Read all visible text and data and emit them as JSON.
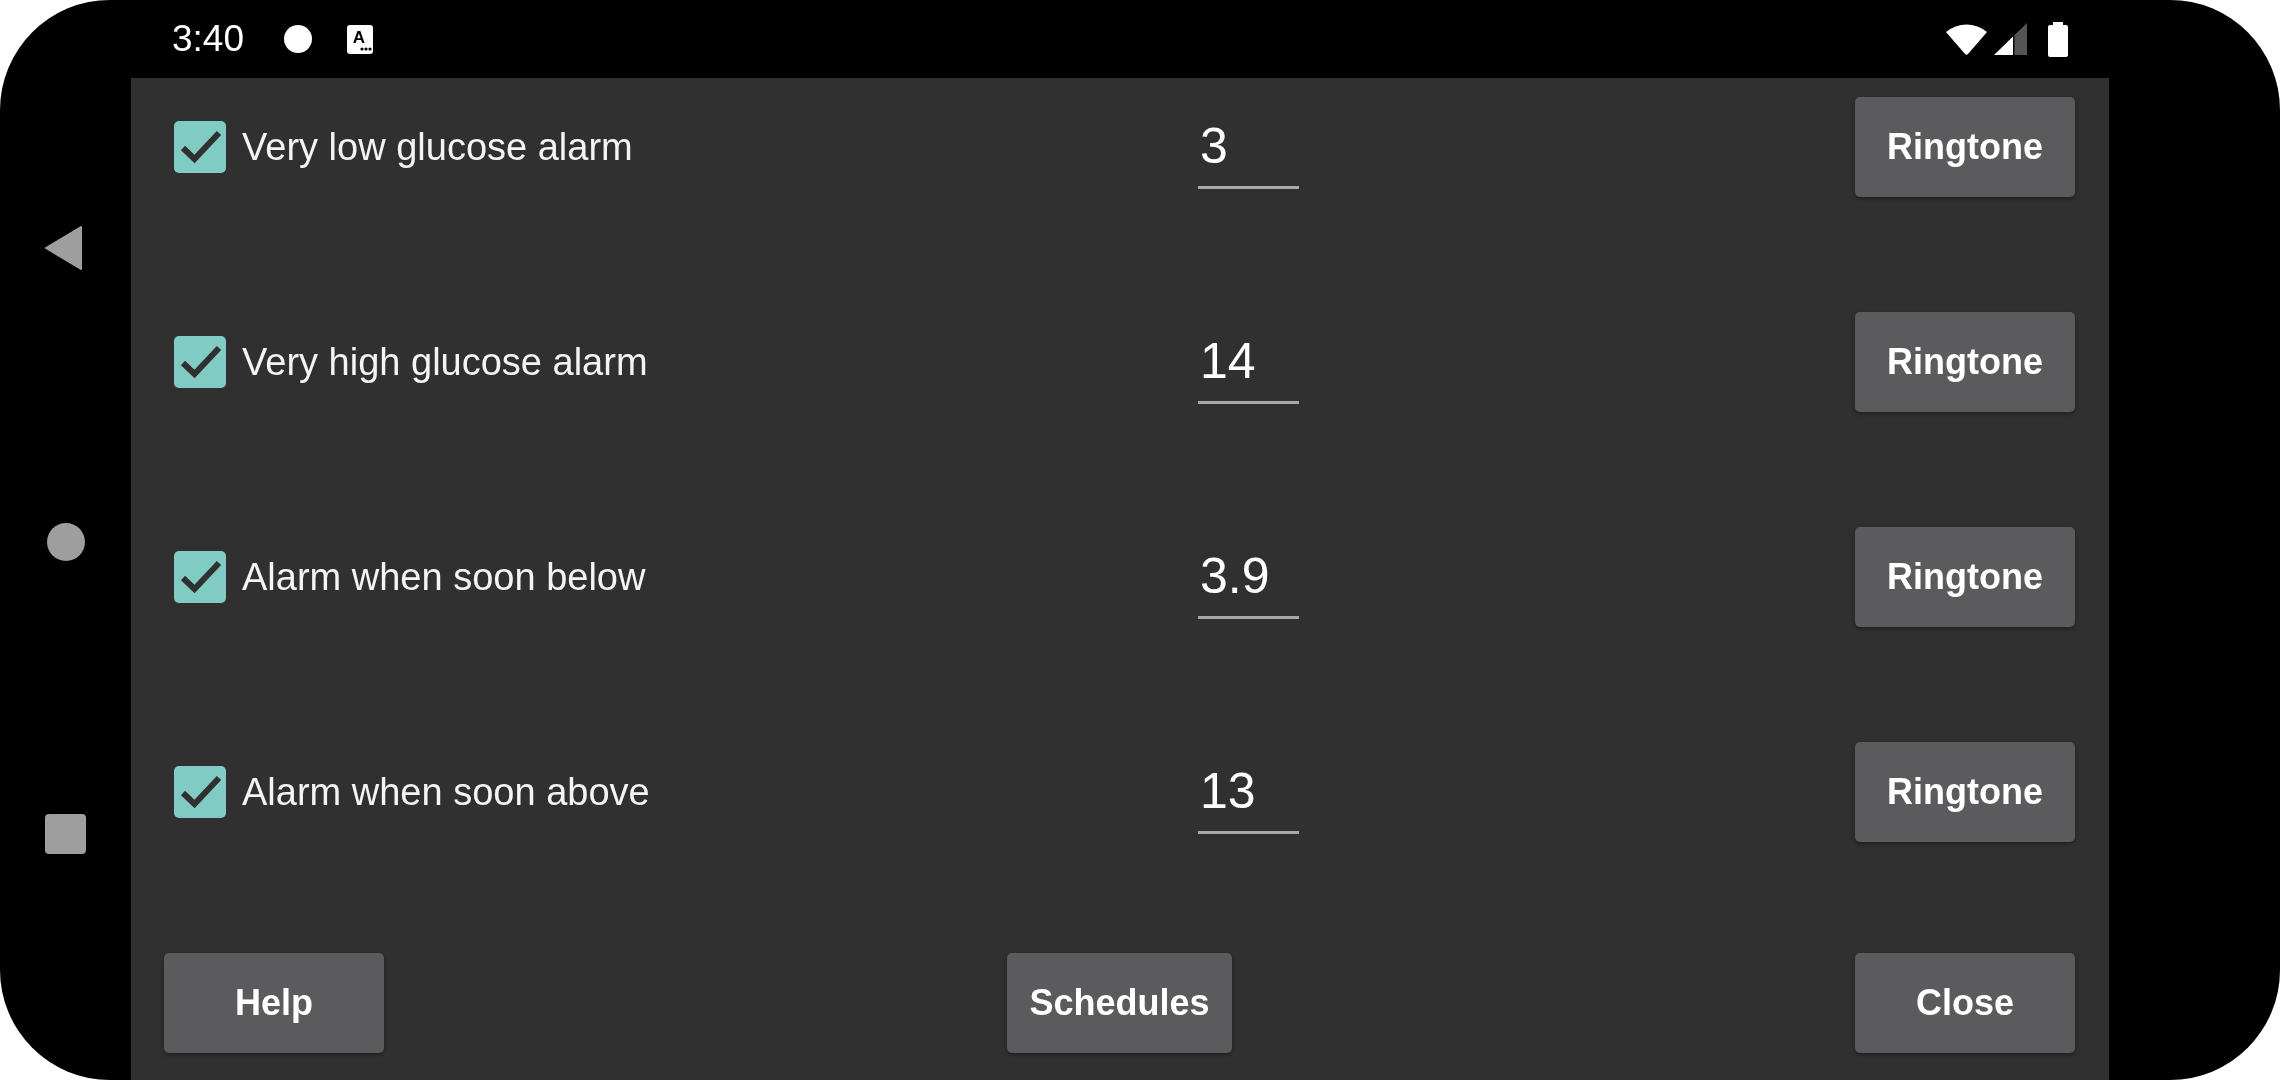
{
  "status_bar": {
    "time": "3:40",
    "notification_letter": "A"
  },
  "alarms": [
    {
      "label": "Very low glucose alarm",
      "checked": true,
      "value": "3",
      "button": "Ringtone"
    },
    {
      "label": "Very high glucose alarm",
      "checked": true,
      "value": "14",
      "button": "Ringtone"
    },
    {
      "label": "Alarm when soon below",
      "checked": true,
      "value": "3.9",
      "button": "Ringtone"
    },
    {
      "label": "Alarm when soon above",
      "checked": true,
      "value": "13",
      "button": "Ringtone"
    }
  ],
  "buttons": [
    {
      "label": "Help"
    },
    {
      "label": "Schedules"
    },
    {
      "label": "Close"
    }
  ]
}
